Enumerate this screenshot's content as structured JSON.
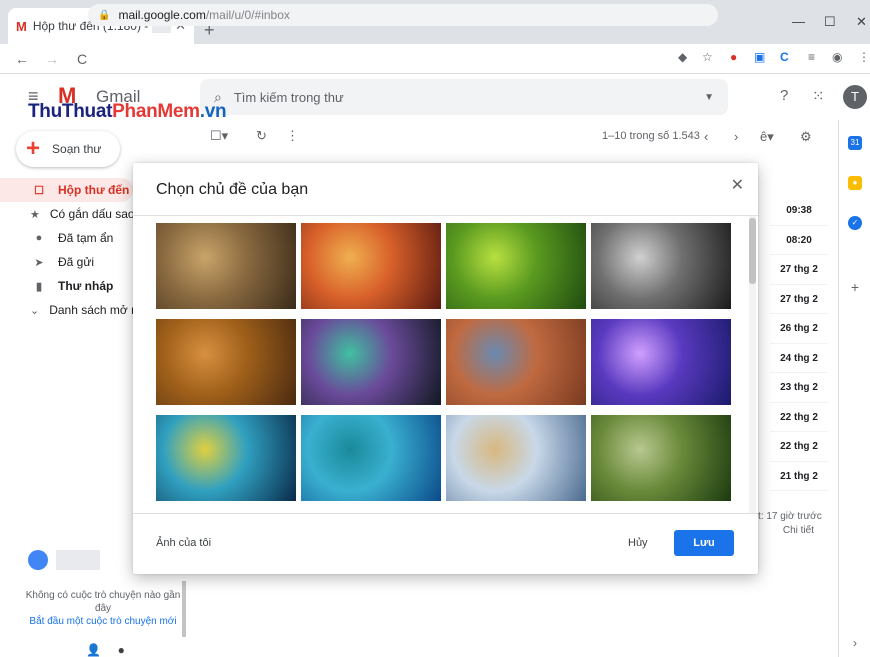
{
  "browser": {
    "tab_title": "Hộp thư đến (1.180) -",
    "url_host": "mail.google.com",
    "url_path": "/mail/u/0/#inbox"
  },
  "gmail": {
    "product": "Gmail",
    "search_placeholder": "Tìm kiếm trong thư",
    "avatar_letter": "T",
    "compose_label": "Soạn thư"
  },
  "watermark": {
    "part1": "ThuThuat",
    "part2": "PhanMem",
    "part3": ".vn"
  },
  "nav": {
    "items": [
      {
        "label": "Hộp thư đến",
        "icon": "inbox-icon",
        "glyph": "☐"
      },
      {
        "label": "Có gắn dấu sao",
        "icon": "star-icon",
        "glyph": "★"
      },
      {
        "label": "Đã tạm ẩn",
        "icon": "clock-icon",
        "glyph": "●"
      },
      {
        "label": "Đã gửi",
        "icon": "send-icon",
        "glyph": "➤"
      },
      {
        "label": "Thư nháp",
        "icon": "draft-icon",
        "glyph": "▮"
      },
      {
        "label": "Danh sách mở rộng",
        "icon": "chevron-down-icon",
        "glyph": "⌄"
      }
    ]
  },
  "hangouts": {
    "empty_text": "Không có cuộc trò chuyện nào gần đây",
    "start_link": "Bắt đầu một cuộc trò chuyện mới"
  },
  "toolbar": {
    "page_info": "1–10 trong số 1.543"
  },
  "inbox_times": [
    "09:38",
    "08:20",
    "27 thg 2",
    "27 thg 2",
    "26 thg 2",
    "24 thg 2",
    "23 thg 2",
    "22 thg 2",
    "22 thg 2",
    "21 thg 2"
  ],
  "footer": {
    "activity": "t: 17 giờ trước",
    "details": "Chi tiết"
  },
  "dialog": {
    "title": "Chọn chủ đề của bạn",
    "my_photos": "Ảnh của tôi",
    "cancel": "Hủy",
    "save": "Lưu",
    "themes": [
      {
        "name": "chess-theme",
        "colors": [
          "#3a2a18",
          "#8a6a40",
          "#c9a46a"
        ]
      },
      {
        "name": "canyon-theme",
        "colors": [
          "#5a1a10",
          "#d8602a",
          "#f0b050"
        ]
      },
      {
        "name": "caterpillar-theme",
        "colors": [
          "#1f4a10",
          "#5a9a20",
          "#b8e040"
        ]
      },
      {
        "name": "pipes-theme",
        "colors": [
          "#1a1a1a",
          "#707070",
          "#d0d0d0"
        ]
      },
      {
        "name": "leaves-theme",
        "colors": [
          "#4a2a10",
          "#a0601a",
          "#d89040"
        ]
      },
      {
        "name": "bokeh-theme",
        "colors": [
          "#101820",
          "#6a4a9a",
          "#40c0a0"
        ]
      },
      {
        "name": "river-canyon-theme",
        "colors": [
          "#7a3a20",
          "#c06a40",
          "#6a8ab0"
        ]
      },
      {
        "name": "jellyfish-theme",
        "colors": [
          "#1a1a6a",
          "#5a3ac0",
          "#d0a0ff"
        ]
      },
      {
        "name": "rainbow-theme",
        "colors": [
          "#0a2a4a",
          "#30a0c0",
          "#e0d040"
        ]
      },
      {
        "name": "lake-theme",
        "colors": [
          "#0a4a8a",
          "#3ab0d0",
          "#1a8a9a"
        ]
      },
      {
        "name": "beach-theme",
        "colors": [
          "#4a6a90",
          "#c8d8e8",
          "#d8b880"
        ]
      },
      {
        "name": "forest-theme",
        "colors": [
          "#1a3a10",
          "#6a8a3a",
          "#b8c890"
        ]
      }
    ]
  }
}
